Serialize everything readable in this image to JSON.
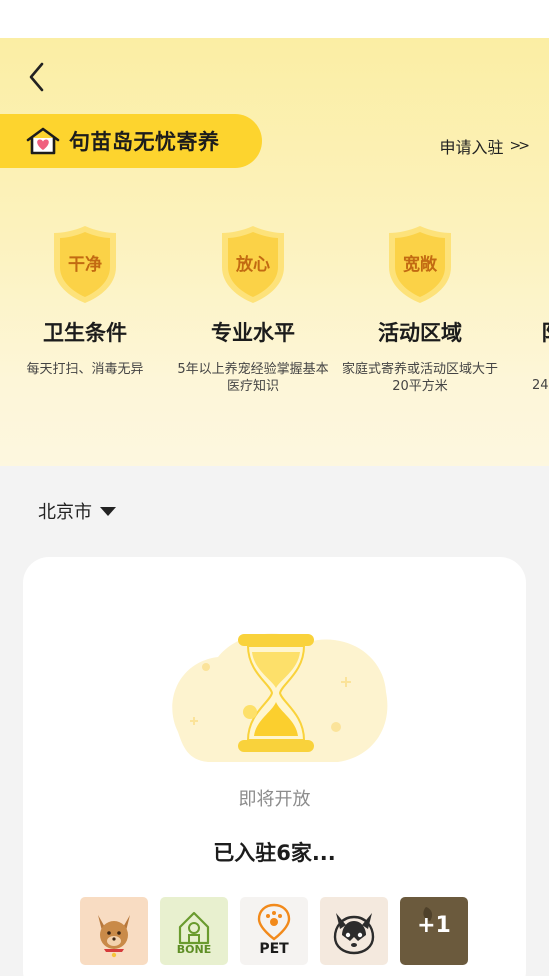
{
  "header": {
    "brand_title": "句苗岛无忧寄养",
    "apply_label": "申请入驻",
    "apply_chevron": ">>"
  },
  "features": [
    {
      "badge": "干净",
      "title": "卫生条件",
      "desc": "每天打扫、消毒无异"
    },
    {
      "badge": "放心",
      "title": "专业水平",
      "desc": "5年以上养宠经验掌握基本医疗知识"
    },
    {
      "badge": "宽敞",
      "title": "活动区域",
      "desc": "家庭式寄养或活动区域大于20平方米"
    },
    {
      "badge": "",
      "title": "阝",
      "desc": "24"
    }
  ],
  "location": {
    "city": "北京市"
  },
  "card": {
    "status": "即将开放",
    "count": "已入驻6家...",
    "logos": [
      {
        "icon": "dog-icon",
        "label": ""
      },
      {
        "icon": "bone-house-icon",
        "label": "BONE"
      },
      {
        "icon": "paw-pin-icon",
        "label": "PET"
      },
      {
        "icon": "husky-icon",
        "label": ""
      },
      {
        "icon": "more-logo-icon",
        "label": "+1"
      }
    ]
  },
  "colors": {
    "accent_yellow": "#fdd42e",
    "shield_text": "#c26a12",
    "background": "#f3f3f3"
  }
}
